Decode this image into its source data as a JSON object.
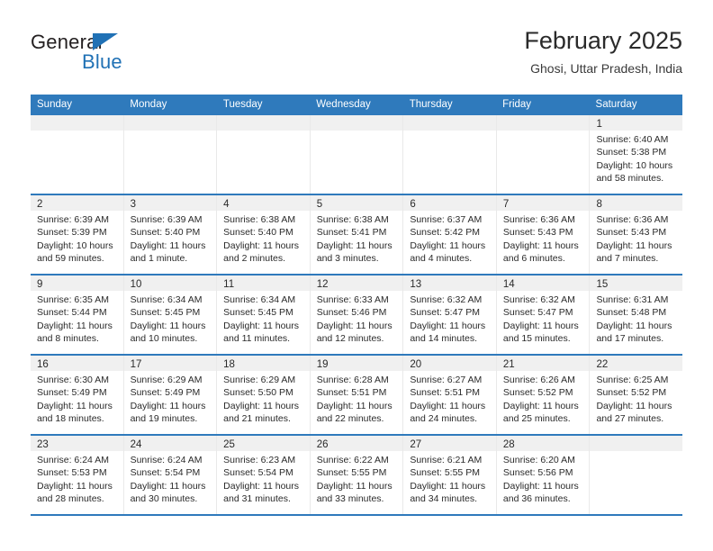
{
  "brand": {
    "name_top": "General",
    "name_bottom": "Blue",
    "accent_color": "#2071b5",
    "triangle_icon": "triangle-icon"
  },
  "header": {
    "month_title": "February 2025",
    "location": "Ghosi, Uttar Pradesh, India"
  },
  "calendar": {
    "header_bg": "#2f7abc",
    "day_band_bg": "#f0f0f0",
    "weekdays": [
      "Sunday",
      "Monday",
      "Tuesday",
      "Wednesday",
      "Thursday",
      "Friday",
      "Saturday"
    ],
    "weeks": [
      [
        {
          "day": "",
          "lines": []
        },
        {
          "day": "",
          "lines": []
        },
        {
          "day": "",
          "lines": []
        },
        {
          "day": "",
          "lines": []
        },
        {
          "day": "",
          "lines": []
        },
        {
          "day": "",
          "lines": []
        },
        {
          "day": "1",
          "lines": [
            "Sunrise: 6:40 AM",
            "Sunset: 5:38 PM",
            "Daylight: 10 hours",
            "and 58 minutes."
          ]
        }
      ],
      [
        {
          "day": "2",
          "lines": [
            "Sunrise: 6:39 AM",
            "Sunset: 5:39 PM",
            "Daylight: 10 hours",
            "and 59 minutes."
          ]
        },
        {
          "day": "3",
          "lines": [
            "Sunrise: 6:39 AM",
            "Sunset: 5:40 PM",
            "Daylight: 11 hours",
            "and 1 minute."
          ]
        },
        {
          "day": "4",
          "lines": [
            "Sunrise: 6:38 AM",
            "Sunset: 5:40 PM",
            "Daylight: 11 hours",
            "and 2 minutes."
          ]
        },
        {
          "day": "5",
          "lines": [
            "Sunrise: 6:38 AM",
            "Sunset: 5:41 PM",
            "Daylight: 11 hours",
            "and 3 minutes."
          ]
        },
        {
          "day": "6",
          "lines": [
            "Sunrise: 6:37 AM",
            "Sunset: 5:42 PM",
            "Daylight: 11 hours",
            "and 4 minutes."
          ]
        },
        {
          "day": "7",
          "lines": [
            "Sunrise: 6:36 AM",
            "Sunset: 5:43 PM",
            "Daylight: 11 hours",
            "and 6 minutes."
          ]
        },
        {
          "day": "8",
          "lines": [
            "Sunrise: 6:36 AM",
            "Sunset: 5:43 PM",
            "Daylight: 11 hours",
            "and 7 minutes."
          ]
        }
      ],
      [
        {
          "day": "9",
          "lines": [
            "Sunrise: 6:35 AM",
            "Sunset: 5:44 PM",
            "Daylight: 11 hours",
            "and 8 minutes."
          ]
        },
        {
          "day": "10",
          "lines": [
            "Sunrise: 6:34 AM",
            "Sunset: 5:45 PM",
            "Daylight: 11 hours",
            "and 10 minutes."
          ]
        },
        {
          "day": "11",
          "lines": [
            "Sunrise: 6:34 AM",
            "Sunset: 5:45 PM",
            "Daylight: 11 hours",
            "and 11 minutes."
          ]
        },
        {
          "day": "12",
          "lines": [
            "Sunrise: 6:33 AM",
            "Sunset: 5:46 PM",
            "Daylight: 11 hours",
            "and 12 minutes."
          ]
        },
        {
          "day": "13",
          "lines": [
            "Sunrise: 6:32 AM",
            "Sunset: 5:47 PM",
            "Daylight: 11 hours",
            "and 14 minutes."
          ]
        },
        {
          "day": "14",
          "lines": [
            "Sunrise: 6:32 AM",
            "Sunset: 5:47 PM",
            "Daylight: 11 hours",
            "and 15 minutes."
          ]
        },
        {
          "day": "15",
          "lines": [
            "Sunrise: 6:31 AM",
            "Sunset: 5:48 PM",
            "Daylight: 11 hours",
            "and 17 minutes."
          ]
        }
      ],
      [
        {
          "day": "16",
          "lines": [
            "Sunrise: 6:30 AM",
            "Sunset: 5:49 PM",
            "Daylight: 11 hours",
            "and 18 minutes."
          ]
        },
        {
          "day": "17",
          "lines": [
            "Sunrise: 6:29 AM",
            "Sunset: 5:49 PM",
            "Daylight: 11 hours",
            "and 19 minutes."
          ]
        },
        {
          "day": "18",
          "lines": [
            "Sunrise: 6:29 AM",
            "Sunset: 5:50 PM",
            "Daylight: 11 hours",
            "and 21 minutes."
          ]
        },
        {
          "day": "19",
          "lines": [
            "Sunrise: 6:28 AM",
            "Sunset: 5:51 PM",
            "Daylight: 11 hours",
            "and 22 minutes."
          ]
        },
        {
          "day": "20",
          "lines": [
            "Sunrise: 6:27 AM",
            "Sunset: 5:51 PM",
            "Daylight: 11 hours",
            "and 24 minutes."
          ]
        },
        {
          "day": "21",
          "lines": [
            "Sunrise: 6:26 AM",
            "Sunset: 5:52 PM",
            "Daylight: 11 hours",
            "and 25 minutes."
          ]
        },
        {
          "day": "22",
          "lines": [
            "Sunrise: 6:25 AM",
            "Sunset: 5:52 PM",
            "Daylight: 11 hours",
            "and 27 minutes."
          ]
        }
      ],
      [
        {
          "day": "23",
          "lines": [
            "Sunrise: 6:24 AM",
            "Sunset: 5:53 PM",
            "Daylight: 11 hours",
            "and 28 minutes."
          ]
        },
        {
          "day": "24",
          "lines": [
            "Sunrise: 6:24 AM",
            "Sunset: 5:54 PM",
            "Daylight: 11 hours",
            "and 30 minutes."
          ]
        },
        {
          "day": "25",
          "lines": [
            "Sunrise: 6:23 AM",
            "Sunset: 5:54 PM",
            "Daylight: 11 hours",
            "and 31 minutes."
          ]
        },
        {
          "day": "26",
          "lines": [
            "Sunrise: 6:22 AM",
            "Sunset: 5:55 PM",
            "Daylight: 11 hours",
            "and 33 minutes."
          ]
        },
        {
          "day": "27",
          "lines": [
            "Sunrise: 6:21 AM",
            "Sunset: 5:55 PM",
            "Daylight: 11 hours",
            "and 34 minutes."
          ]
        },
        {
          "day": "28",
          "lines": [
            "Sunrise: 6:20 AM",
            "Sunset: 5:56 PM",
            "Daylight: 11 hours",
            "and 36 minutes."
          ]
        },
        {
          "day": "",
          "lines": []
        }
      ]
    ]
  }
}
